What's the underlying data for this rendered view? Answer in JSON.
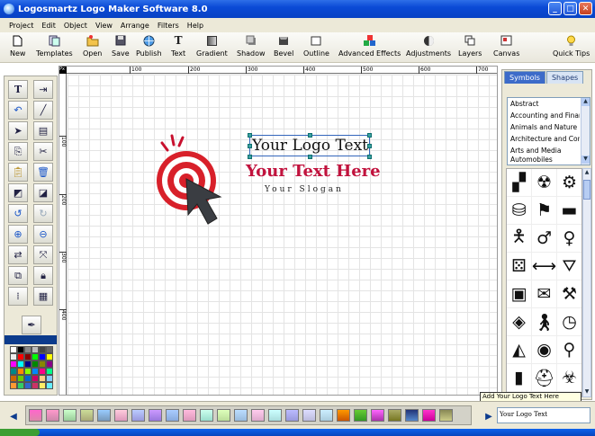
{
  "window": {
    "title": "Logosmartz Logo Maker Software 8.0"
  },
  "menu": [
    "Project",
    "Edit",
    "Object",
    "View",
    "Arrange",
    "Filters",
    "Help"
  ],
  "toolbar": [
    {
      "label": "New",
      "icon": "new-file-icon"
    },
    {
      "label": "Templates",
      "icon": "templates-icon"
    },
    {
      "label": "Open",
      "icon": "open-folder-icon"
    },
    {
      "label": "Save",
      "icon": "save-disk-icon"
    },
    {
      "label": "Publish",
      "icon": "publish-globe-icon"
    },
    {
      "label": "Text",
      "icon": "text-icon"
    },
    {
      "label": "Gradient",
      "icon": "gradient-icon"
    },
    {
      "label": "Shadow",
      "icon": "shadow-icon"
    },
    {
      "label": "Bevel",
      "icon": "bevel-icon"
    },
    {
      "label": "Outline",
      "icon": "outline-icon"
    },
    {
      "label": "Advanced Effects",
      "icon": "advanced-effects-icon"
    },
    {
      "label": "Adjustments",
      "icon": "adjustments-icon"
    },
    {
      "label": "Layers",
      "icon": "layers-icon"
    },
    {
      "label": "Canvas",
      "icon": "canvas-icon"
    },
    {
      "label": "Quick Tips",
      "icon": "lightbulb-icon"
    }
  ],
  "ruler": {
    "corner": "Px",
    "h_ticks": [
      "100",
      "200",
      "300",
      "400",
      "500",
      "600",
      "700"
    ],
    "v_ticks": [
      "100",
      "200",
      "300",
      "400"
    ]
  },
  "canvas": {
    "logo_text": "Your Logo Text",
    "tagline": "Your Text Here",
    "slogan": "Your Slogan",
    "tagline_color": "#c1123d"
  },
  "right_panel": {
    "tabs": [
      "Symbols",
      "Shapes"
    ],
    "active_tab": "Symbols",
    "categories": [
      "Abstract",
      "Accounting and Finance",
      "Animals and Nature",
      "Architecture and Construction",
      "Arts and Media",
      "Automobiles"
    ]
  },
  "bottom": {
    "text_input_value": "Your Logo Text",
    "tooltip": "Add Your Logo Text Here"
  }
}
